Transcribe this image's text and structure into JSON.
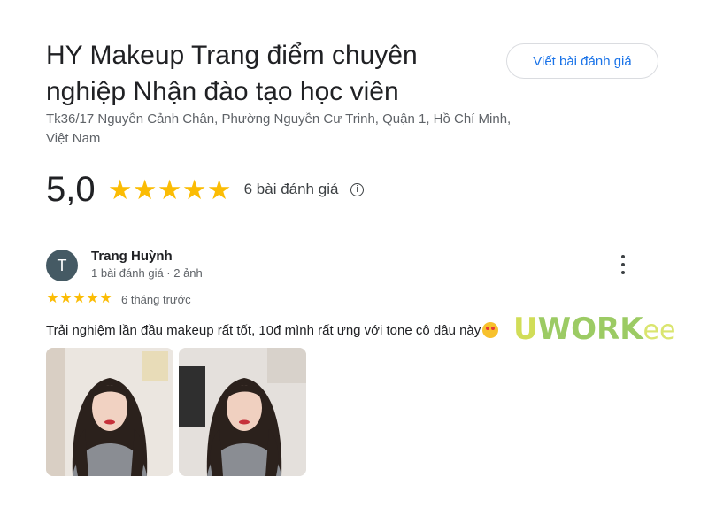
{
  "business": {
    "name": "HY Makeup Trang điểm chuyên nghiệp Nhận đào tạo học viên",
    "address": "Tk36/17 Nguyễn Cảnh Chân, Phường Nguyễn Cư Trinh, Quận 1, Hồ Chí Minh, Việt Nam",
    "write_review_label": "Viết bài đánh giá"
  },
  "rating": {
    "value": "5,0",
    "stars": 5,
    "count_label": "6 bài đánh giá",
    "info_icon": "info-icon",
    "star_color": "#fbbc04"
  },
  "review": {
    "avatar_initial": "T",
    "avatar_color": "#455a64",
    "author": "Trang Huỳnh",
    "meta": "1 bài đánh giá · 2 ảnh",
    "stars": 5,
    "time": "6 tháng trước",
    "text": "Trải nghiệm lần đầu makeup rất tốt, 10đ mình rất ưng với tone cô dâu này",
    "emoji": "smiling-face-with-hearts",
    "photos": [
      {
        "name": "review-photo-1"
      },
      {
        "name": "review-photo-2"
      }
    ]
  },
  "watermark": {
    "part1": "U",
    "part2": "WORK",
    "part3": "ee"
  },
  "accent": "#1a73e8"
}
